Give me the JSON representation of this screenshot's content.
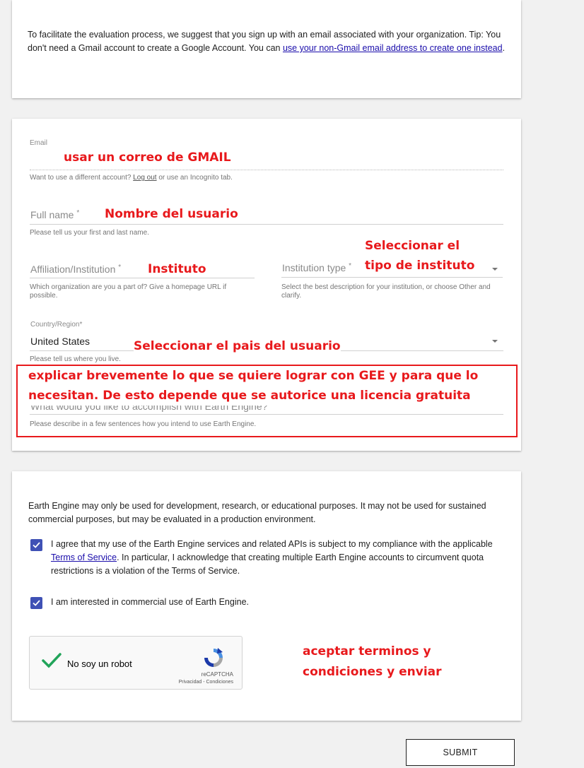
{
  "intro": {
    "text_before_link": "To facilitate the evaluation process, we suggest that you sign up with an email associated with your organization. Tip: You don't need a Gmail account to create a Google Account. You can ",
    "link": "use your non-Gmail email address to create one instead",
    "text_after_link": "."
  },
  "form": {
    "email_label": "Email",
    "email_hint_before": "Want to use a different account? ",
    "email_hint_link": "Log out",
    "email_hint_after": " or use an Incognito tab.",
    "fullname_label": "Full name",
    "fullname_hint": "Please tell us your first and last name.",
    "affiliation_label": "Affiliation/Institution",
    "affiliation_hint": "Which organization are you a part of? Give a homepage URL if possible.",
    "institution_type_label": "Institution type",
    "institution_type_hint": "Select the best description for your institution, or choose Other and clarify.",
    "country_label": "Country/Region",
    "country_value": "United States",
    "country_hint": "Please tell us where you live.",
    "accomplish_label": "What would you like to accomplish with Earth Engine?",
    "accomplish_hint": "Please describe in a few sentences how you intend to use Earth Engine.",
    "required_mark": "*"
  },
  "annotations": {
    "email": "usar un correo de GMAIL",
    "fullname": "Nombre del usuario",
    "affiliation": "Instituto",
    "institution_type_line1": "Seleccionar el",
    "institution_type_line2": "tipo de instituto",
    "country": "Seleccionar el pais del usuario",
    "accomplish_line1": "explicar brevemente lo que se quiere lograr con GEE y para que lo",
    "accomplish_line2": "necesitan. De esto depende que se autorice una licencia gratuita",
    "submit_line1": "aceptar terminos y",
    "submit_line2": "condiciones y enviar"
  },
  "terms": {
    "notice": "Earth Engine may only be used for development, research, or educational purposes. It may not be used for sustained commercial purposes, but may be evaluated in a production environment.",
    "agree_before": "I agree that my use of the Earth Engine services and related APIs is subject to my compliance with the applicable ",
    "agree_link": "Terms of Service",
    "agree_after": ". In particular, I acknowledge that creating multiple Earth Engine accounts to circumvent quota restrictions is a violation of the Terms of Service.",
    "agree_checked": true,
    "commercial": "I am interested in commercial use of Earth Engine.",
    "commercial_checked": true
  },
  "recaptcha": {
    "label": "No soy un robot",
    "brand": "reCAPTCHA",
    "links": "Privacidad - Condiciones"
  },
  "submit_label": "SUBMIT",
  "colors": {
    "annotation": "#e8191c",
    "checkbox": "#3f51b5",
    "link": "#1a0dab",
    "check_green": "#22a45a"
  }
}
